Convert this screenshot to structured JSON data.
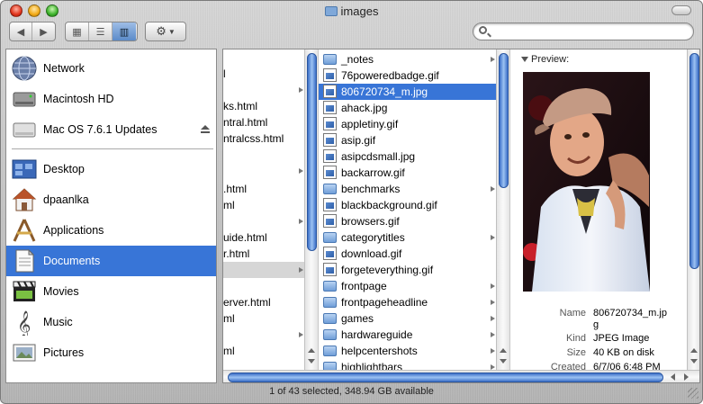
{
  "window": {
    "title": "images"
  },
  "search": {
    "value": "",
    "placeholder": ""
  },
  "sidebar": {
    "items": [
      {
        "label": "Network",
        "icon": "network-globe-icon"
      },
      {
        "label": "Macintosh HD",
        "icon": "hard-drive-icon"
      },
      {
        "label": "Mac OS 7.6.1 Updates",
        "icon": "disk-volume-icon"
      },
      {
        "label": "Desktop",
        "icon": "desktop-icon"
      },
      {
        "label": "dpaanlka",
        "icon": "home-icon"
      },
      {
        "label": "Applications",
        "icon": "applications-icon"
      },
      {
        "label": "Documents",
        "icon": "documents-icon",
        "selected": true
      },
      {
        "label": "Movies",
        "icon": "movies-icon"
      },
      {
        "label": "Music",
        "icon": "music-icon"
      },
      {
        "label": "Pictures",
        "icon": "pictures-icon"
      }
    ]
  },
  "column1": {
    "rows": [
      "l",
      "",
      "ks.html",
      "ntral.html",
      "ntralcss.html",
      "",
      "",
      ".html",
      "ml",
      "",
      "uide.html",
      "r.html",
      "",
      "erver.html",
      "ml",
      "",
      "ml",
      "",
      ""
    ]
  },
  "column2": {
    "rows": [
      {
        "name": "_notes",
        "kind": "folder"
      },
      {
        "name": "76poweredbadge.gif",
        "kind": "image"
      },
      {
        "name": "806720734_m.jpg",
        "kind": "image",
        "selected": true
      },
      {
        "name": "ahack.jpg",
        "kind": "image"
      },
      {
        "name": "appletiny.gif",
        "kind": "image"
      },
      {
        "name": "asip.gif",
        "kind": "image"
      },
      {
        "name": "asipcdsmall.jpg",
        "kind": "image"
      },
      {
        "name": "backarrow.gif",
        "kind": "image"
      },
      {
        "name": "benchmarks",
        "kind": "folder"
      },
      {
        "name": "blackbackground.gif",
        "kind": "image"
      },
      {
        "name": "browsers.gif",
        "kind": "image"
      },
      {
        "name": "categorytitles",
        "kind": "folder"
      },
      {
        "name": "download.gif",
        "kind": "image"
      },
      {
        "name": "forgeteverything.gif",
        "kind": "image"
      },
      {
        "name": "frontpage",
        "kind": "folder"
      },
      {
        "name": "frontpageheadline",
        "kind": "folder"
      },
      {
        "name": "games",
        "kind": "folder"
      },
      {
        "name": "hardwareguide",
        "kind": "folder"
      },
      {
        "name": "helpcentershots",
        "kind": "folder"
      },
      {
        "name": "highlightbars",
        "kind": "folder"
      }
    ]
  },
  "preview": {
    "label": "Preview:",
    "info": [
      {
        "key": "Name",
        "value": "806720734_m.jp"
      },
      {
        "key": "",
        "value": "g"
      },
      {
        "key": "Kind",
        "value": "JPEG Image"
      },
      {
        "key": "Size",
        "value": "40 KB on disk"
      },
      {
        "key": "Created",
        "value": "6/7/06 6:48 PM"
      }
    ]
  },
  "status": {
    "text": "1 of 43 selected, 348.94 GB available"
  },
  "colors": {
    "selection": "#3875d7",
    "folder": "#6f9ed8"
  }
}
